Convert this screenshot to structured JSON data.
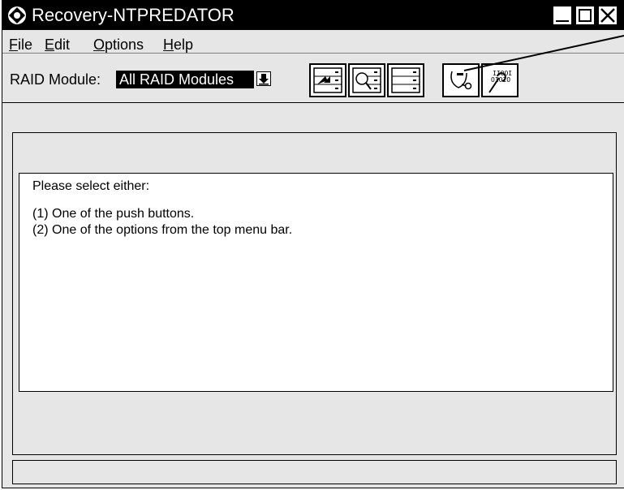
{
  "window": {
    "title": "Recovery-NTPREDATOR",
    "controls": [
      "minimize",
      "maximize",
      "close"
    ]
  },
  "menu": {
    "items": [
      {
        "mnemonic": "F",
        "rest": "ile"
      },
      {
        "mnemonic": "E",
        "rest": "dit"
      },
      {
        "mnemonic": "O",
        "rest": "ptions"
      },
      {
        "mnemonic": "H",
        "rest": "elp"
      }
    ]
  },
  "toolbar": {
    "raid_label": "RAID Module:",
    "raid_value": "All RAID Modules",
    "buttons": [
      "module-transfer-icon",
      "search-drive-icon",
      "drive-list-icon",
      "stethoscope-icon",
      "binary-wrench-icon"
    ]
  },
  "message": {
    "line1": "Please select either:",
    "line2": "(1) One of the push buttons.",
    "line3": "(2) One of the options from the top menu bar."
  },
  "status": {
    "text": ""
  }
}
